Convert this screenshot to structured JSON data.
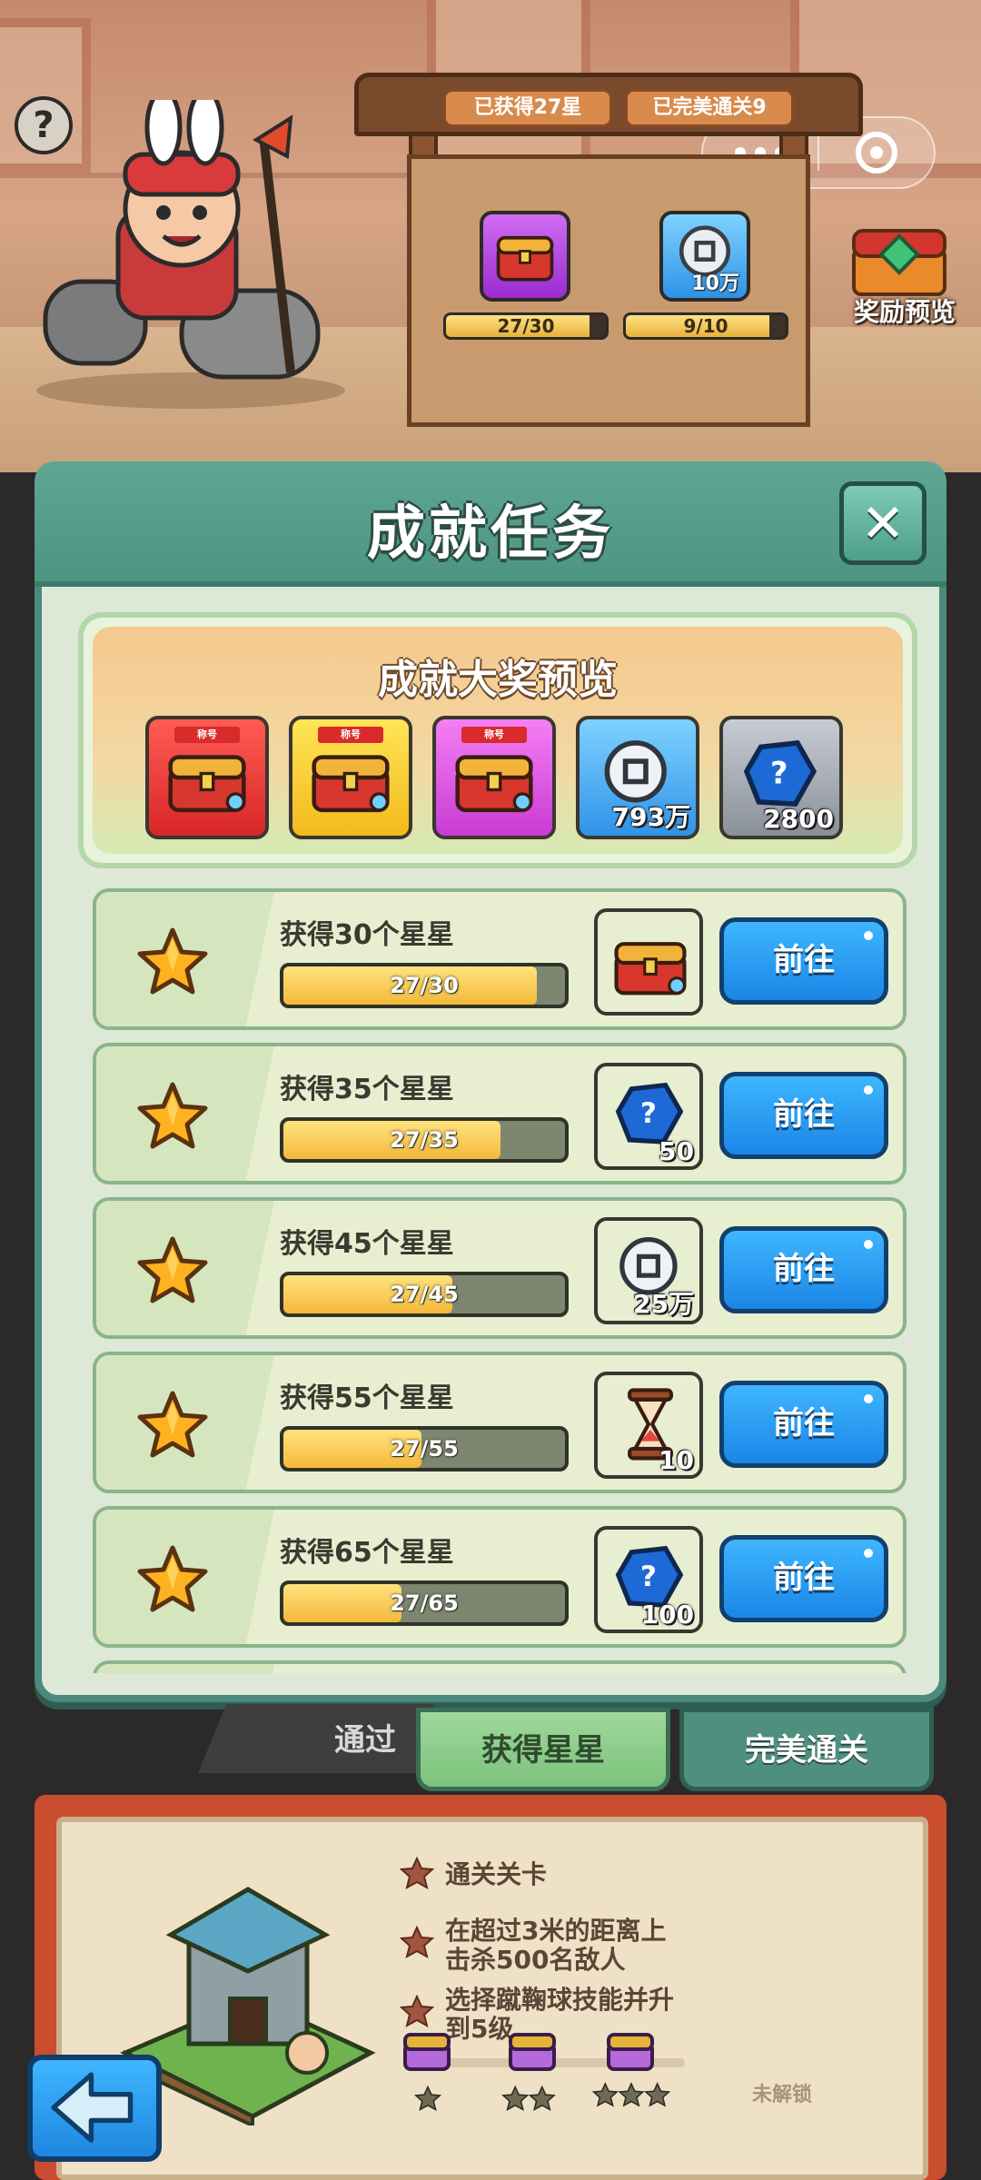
{
  "top_hud": {
    "help_label": "?",
    "board": {
      "stars_tag": "已获得27星",
      "perfect_tag": "已完美通关9",
      "stars_progress": "27/30",
      "stars_progress_value": 0.9,
      "perfect_progress": "9/10",
      "perfect_progress_value": 0.9,
      "coin_reward_count": "10万"
    },
    "reward_preview_label": "奖励预览"
  },
  "modal": {
    "title": "成就任务",
    "close_label": "✕",
    "grand_prize": {
      "title": "成就大奖预览",
      "items": [
        {
          "type": "title-chest",
          "color": "#e8352f",
          "tag": "称号",
          "count": ""
        },
        {
          "type": "title-chest",
          "color": "#f5c21f",
          "tag": "称号",
          "count": ""
        },
        {
          "type": "title-chest",
          "color": "#e25be6",
          "tag": "称号",
          "count": ""
        },
        {
          "type": "coin",
          "color": "#3aa0ee",
          "tag": "",
          "count": "793万"
        },
        {
          "type": "gem",
          "color": "#9aa0a8",
          "tag": "",
          "count": "2800"
        }
      ]
    },
    "tasks": [
      {
        "label": "获得30个星星",
        "progress_text": "27/30",
        "progress": 0.9,
        "reward_type": "title-chest",
        "reward_color": "purple",
        "reward_count": "",
        "button": "前往"
      },
      {
        "label": "获得35个星星",
        "progress_text": "27/35",
        "progress": 0.771,
        "reward_type": "gem",
        "reward_color": "gray",
        "reward_count": "50",
        "button": "前往"
      },
      {
        "label": "获得45个星星",
        "progress_text": "27/45",
        "progress": 0.6,
        "reward_type": "coin",
        "reward_color": "blue",
        "reward_count": "25万",
        "button": "前往"
      },
      {
        "label": "获得55个星星",
        "progress_text": "27/55",
        "progress": 0.491,
        "reward_type": "hourglass",
        "reward_color": "gold",
        "reward_count": "10",
        "button": "前往"
      },
      {
        "label": "获得65个星星",
        "progress_text": "27/65",
        "progress": 0.415,
        "reward_type": "gem",
        "reward_color": "gray",
        "reward_count": "100",
        "button": "前往"
      }
    ]
  },
  "tabs": {
    "behind_label": "通过",
    "items": [
      {
        "label": "获得星星",
        "active": true
      },
      {
        "label": "完美通关",
        "active": false
      }
    ]
  },
  "book": {
    "requirements": [
      "通关关卡",
      "在超过3米的距离上\n击杀500名敌人",
      "选择蹴鞠球技能并升\n到5级"
    ],
    "locked_label": "未解锁"
  }
}
